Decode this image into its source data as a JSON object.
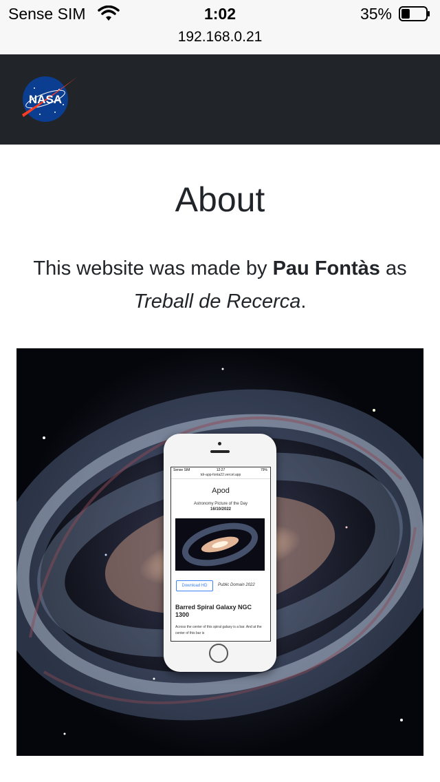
{
  "status_bar": {
    "carrier": "Sense SIM",
    "time": "1:02",
    "battery_percent": "35%",
    "battery_level": 0.35,
    "wifi_icon": "wifi-icon",
    "battery_icon": "battery-icon"
  },
  "browser": {
    "url": "192.168.0.21"
  },
  "navbar": {
    "logo_icon": "nasa-logo-icon",
    "logo_text": "NASA",
    "background": "#212529"
  },
  "page": {
    "title": "About",
    "desc_prefix": "This website was made by ",
    "author": "Pau Fontàs",
    "desc_middle": " as ",
    "project": "Treball de Recerca",
    "desc_suffix": "."
  },
  "mockup": {
    "status_left": "Sense SIM",
    "status_time": "12:27",
    "status_right": "79%",
    "url": "tdr-app-fonta22.vercel.app",
    "title": "Apod",
    "subtitle": "Astronomy Picture of the Day",
    "date": "16/10/2022",
    "download_label": "Download HD",
    "license": "Public Domain 2022",
    "heading": "Barred Spiral Galaxy NGC 1300",
    "text": "Across the center of this spiral galaxy is a bar. And at the center of this bar is"
  }
}
